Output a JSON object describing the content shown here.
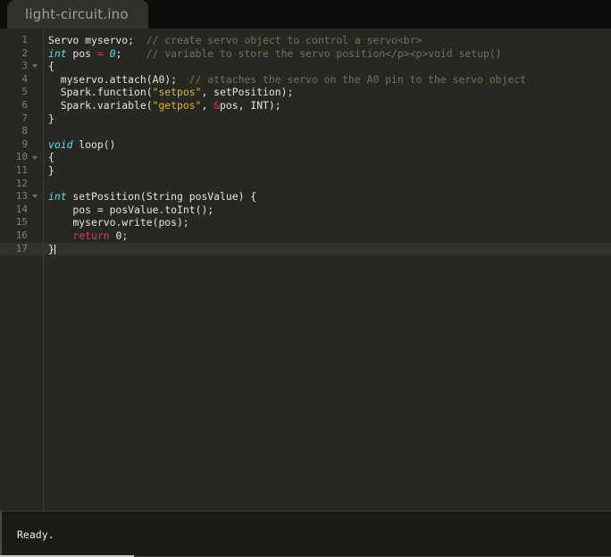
{
  "window": {
    "background_color": "#0d0e0c"
  },
  "tabbar": {
    "tabs": [
      {
        "label": "light-circuit.ino",
        "active": true
      }
    ]
  },
  "editor": {
    "background_color": "#262821",
    "active_line": 17,
    "gutter": {
      "fold_lines": [
        3,
        10,
        13
      ]
    },
    "lines": [
      {
        "number": 1,
        "tokens": [
          {
            "text": "Servo myservo;",
            "kind": "ident"
          },
          {
            "text": "  ",
            "kind": "plain"
          },
          {
            "text": "// create servo object to control a servo<br>",
            "kind": "comment"
          }
        ]
      },
      {
        "number": 2,
        "tokens": [
          {
            "text": "int",
            "kind": "type"
          },
          {
            "text": " pos ",
            "kind": "ident"
          },
          {
            "text": "=",
            "kind": "op"
          },
          {
            "text": " ",
            "kind": "plain"
          },
          {
            "text": "0",
            "kind": "number-cyan"
          },
          {
            "text": ";",
            "kind": "punct"
          },
          {
            "text": "    ",
            "kind": "plain"
          },
          {
            "text": "// variable to store the servo position</p><p>void setup()",
            "kind": "comment"
          }
        ]
      },
      {
        "number": 3,
        "tokens": [
          {
            "text": "{",
            "kind": "punct"
          }
        ]
      },
      {
        "number": 4,
        "tokens": [
          {
            "text": "  myservo.attach(A0);",
            "kind": "ident"
          },
          {
            "text": "  ",
            "kind": "plain"
          },
          {
            "text": "// attaches the servo on the A0 pin to the servo object",
            "kind": "comment"
          }
        ]
      },
      {
        "number": 5,
        "tokens": [
          {
            "text": "  Spark.function(",
            "kind": "ident"
          },
          {
            "text": "\"setpos\"",
            "kind": "string"
          },
          {
            "text": ", setPosition);",
            "kind": "ident"
          }
        ]
      },
      {
        "number": 6,
        "tokens": [
          {
            "text": "  Spark.variable(",
            "kind": "ident"
          },
          {
            "text": "\"getpos\"",
            "kind": "string"
          },
          {
            "text": ", ",
            "kind": "ident"
          },
          {
            "text": "&",
            "kind": "op"
          },
          {
            "text": "pos, INT);",
            "kind": "ident"
          }
        ]
      },
      {
        "number": 7,
        "tokens": [
          {
            "text": "}",
            "kind": "punct"
          }
        ]
      },
      {
        "number": 8,
        "tokens": []
      },
      {
        "number": 9,
        "tokens": [
          {
            "text": "void",
            "kind": "type"
          },
          {
            "text": " loop()",
            "kind": "ident"
          }
        ]
      },
      {
        "number": 10,
        "tokens": [
          {
            "text": "{",
            "kind": "punct"
          }
        ]
      },
      {
        "number": 11,
        "tokens": [
          {
            "text": "}",
            "kind": "punct"
          }
        ]
      },
      {
        "number": 12,
        "tokens": []
      },
      {
        "number": 13,
        "tokens": [
          {
            "text": "int",
            "kind": "type"
          },
          {
            "text": " setPosition(String posValue) {",
            "kind": "ident"
          }
        ]
      },
      {
        "number": 14,
        "tokens": [
          {
            "text": "    pos = posValue.toInt();",
            "kind": "ident"
          }
        ]
      },
      {
        "number": 15,
        "tokens": [
          {
            "text": "    myservo.write(pos);",
            "kind": "ident"
          }
        ]
      },
      {
        "number": 16,
        "tokens": [
          {
            "text": "    ",
            "kind": "plain"
          },
          {
            "text": "return",
            "kind": "keyword"
          },
          {
            "text": " ",
            "kind": "plain"
          },
          {
            "text": "0",
            "kind": "number-white"
          },
          {
            "text": ";",
            "kind": "punct"
          }
        ]
      },
      {
        "number": 17,
        "tokens": [
          {
            "text": "}",
            "kind": "punct"
          }
        ],
        "caret_after": true
      }
    ]
  },
  "statusbar": {
    "message": "Ready."
  }
}
